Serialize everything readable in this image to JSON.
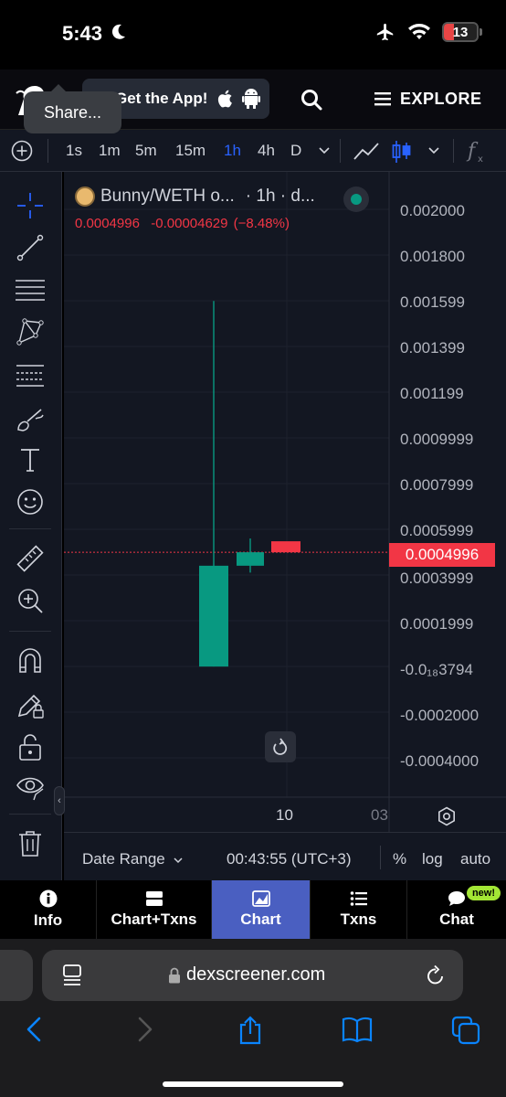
{
  "status_bar": {
    "time": "5:43",
    "battery": "13"
  },
  "header": {
    "get_app_label": "Get the App!",
    "share_tooltip": "Share...",
    "explore_label": "EXPLORE"
  },
  "toolbar": {
    "timeframes": [
      "1s",
      "1m",
      "5m",
      "15m",
      "1h",
      "4h",
      "D"
    ],
    "active_timeframe": "1h"
  },
  "chart": {
    "title": "Bunny/WETH o...",
    "interval_info": "· 1h · d...",
    "last_price": "0.0004996",
    "change": "-0.00004629",
    "change_pct": "(−8.48%)",
    "price_scale": [
      "0.002000",
      "0.001800",
      "0.001599",
      "0.001399",
      "0.001199",
      "0.0009999",
      "0.0007999",
      "0.0005999",
      "0.0003999",
      "0.0001999",
      "-0.0₁₈3794",
      "-0.0002000",
      "-0.0004000"
    ],
    "current_price_tag": "0.0004996",
    "time_labels": [
      "10",
      "03"
    ],
    "colors": {
      "up": "#089981",
      "down": "#f23645",
      "accent": "#2962ff"
    }
  },
  "chart_data": {
    "type": "candlestick",
    "title": "Bunny/WETH",
    "interval": "1h",
    "ylim": [
      -0.0005,
      0.0021
    ],
    "candles": [
      {
        "open": -6e-07,
        "close": 0.0004406,
        "high": 0.001599,
        "low": -6e-07,
        "color": "green"
      },
      {
        "open": 0.0004406,
        "close": 0.0004996,
        "high": 0.0005599,
        "low": 0.0004106,
        "color": "green"
      },
      {
        "open": 0.0004996,
        "close": 0.0004996,
        "high": 0.0004996,
        "low": 0.0004996,
        "color": "red"
      }
    ],
    "current_price": 0.0004996
  },
  "chart_bottom": {
    "date_range_label": "Date Range",
    "clock": "00:43:55 (UTC+3)",
    "percent_label": "%",
    "log_label": "log",
    "auto_label": "auto"
  },
  "tabs": [
    {
      "label": "Info",
      "icon": "info-icon",
      "width": 106
    },
    {
      "label": "Chart+Txns",
      "icon": "chart-txns-icon",
      "width": 126
    },
    {
      "label": "Chart",
      "icon": "chart-icon",
      "width": 108
    },
    {
      "label": "Txns",
      "icon": "list-icon",
      "width": 106
    },
    {
      "label": "Chat",
      "icon": "chat-icon",
      "width": 108
    }
  ],
  "active_tab": "Chart",
  "chat_badge": "new!",
  "safari": {
    "url": "dexscreener.com"
  }
}
